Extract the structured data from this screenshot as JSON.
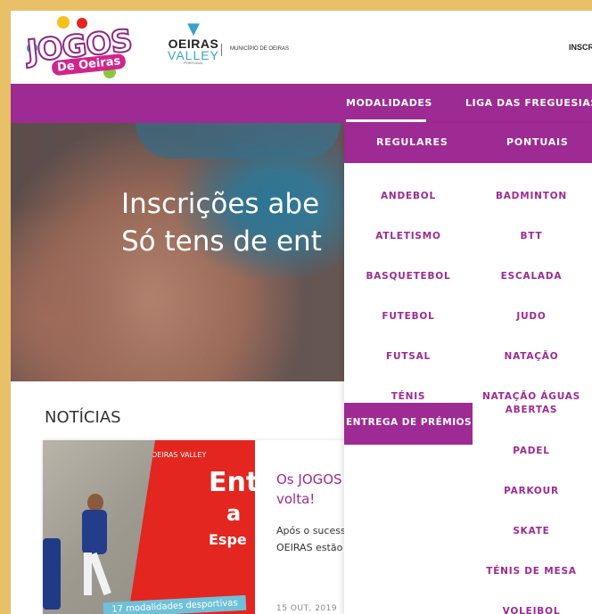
{
  "header": {
    "logo_text": "JOGOS",
    "logo_sub": "De Oeiras",
    "partner_line1": "OEIRAS",
    "partner_line2": "VALLEY",
    "partner_line3": "PORTUGAL",
    "municipio": "MUNICÍPIO DE OEIRAS",
    "inscr": "INSCR"
  },
  "nav": {
    "items": [
      "MODALIDADES",
      "LIGA DAS FREGUESIAS"
    ]
  },
  "hero": {
    "line1": "Inscrições abe",
    "line2": "Só tens de ent"
  },
  "news": {
    "section_title": "NOTÍCIAS",
    "image_oeiras": "OEIRAS VALLEY",
    "image_text1": "Ent",
    "image_text2": "a",
    "image_text3": "Espe",
    "image_strip": "17 modalidades desportivas",
    "headline_line1": "Os JOGOS",
    "headline_line2": "volta!",
    "body_line1": "Após o sucess",
    "body_line2": "OEIRAS estão",
    "date": "15 OUT, 2019"
  },
  "dropdown": {
    "col1_title": "REGULARES",
    "col2_title": "PONTUAIS",
    "col1": [
      "ANDEBOL",
      "ATLETISMO",
      "BASQUETEBOL",
      "FUTEBOL",
      "FUTSAL",
      "TÉNIS"
    ],
    "col1_highlight": "ENTREGA DE PRÉMIOS",
    "col2": [
      "BADMINTON",
      "BTT",
      "ESCALADA",
      "JUDO",
      "NATAÇÃO",
      "NATAÇÃO ÁGUAS ABERTAS",
      "PADEL",
      "PARKOUR",
      "SKATE",
      "TÉNIS DE MESA",
      "VOLEIBOL"
    ]
  },
  "colors": {
    "brand_purple": "#9e2a93",
    "frame_gold": "#e8c068"
  }
}
